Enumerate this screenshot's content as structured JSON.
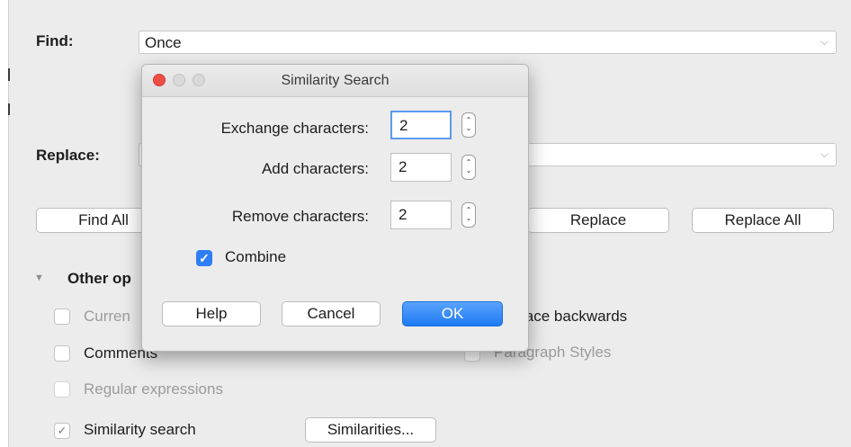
{
  "find": {
    "label": "Find:",
    "value": "Once",
    "chevron": "⌵"
  },
  "replace": {
    "label": "Replace:",
    "chevron": "⌵"
  },
  "buttons": {
    "find_all": "Find All",
    "replace": "Replace",
    "replace_all": "Replace All"
  },
  "other_options": {
    "label": "Other op"
  },
  "options": {
    "current": "Curren",
    "replace_backwards": "lace backwards",
    "comments": "Comments",
    "paragraph_styles": "Paragraph Styles",
    "regular_expressions": "Regular expressions",
    "similarity_search": "Similarity search",
    "similarities_button": "Similarities..."
  },
  "dialog": {
    "title": "Similarity Search",
    "exchange_label": "Exchange characters:",
    "exchange_value": "2",
    "add_label": "Add characters:",
    "add_value": "2",
    "remove_label": "Remove characters:",
    "remove_value": "2",
    "combine_label": "Combine",
    "combine_checked": true,
    "help": "Help",
    "cancel": "Cancel",
    "ok": "OK"
  },
  "colors": {
    "accent": "#1e7bf1",
    "close_light": "#ed4f46"
  }
}
